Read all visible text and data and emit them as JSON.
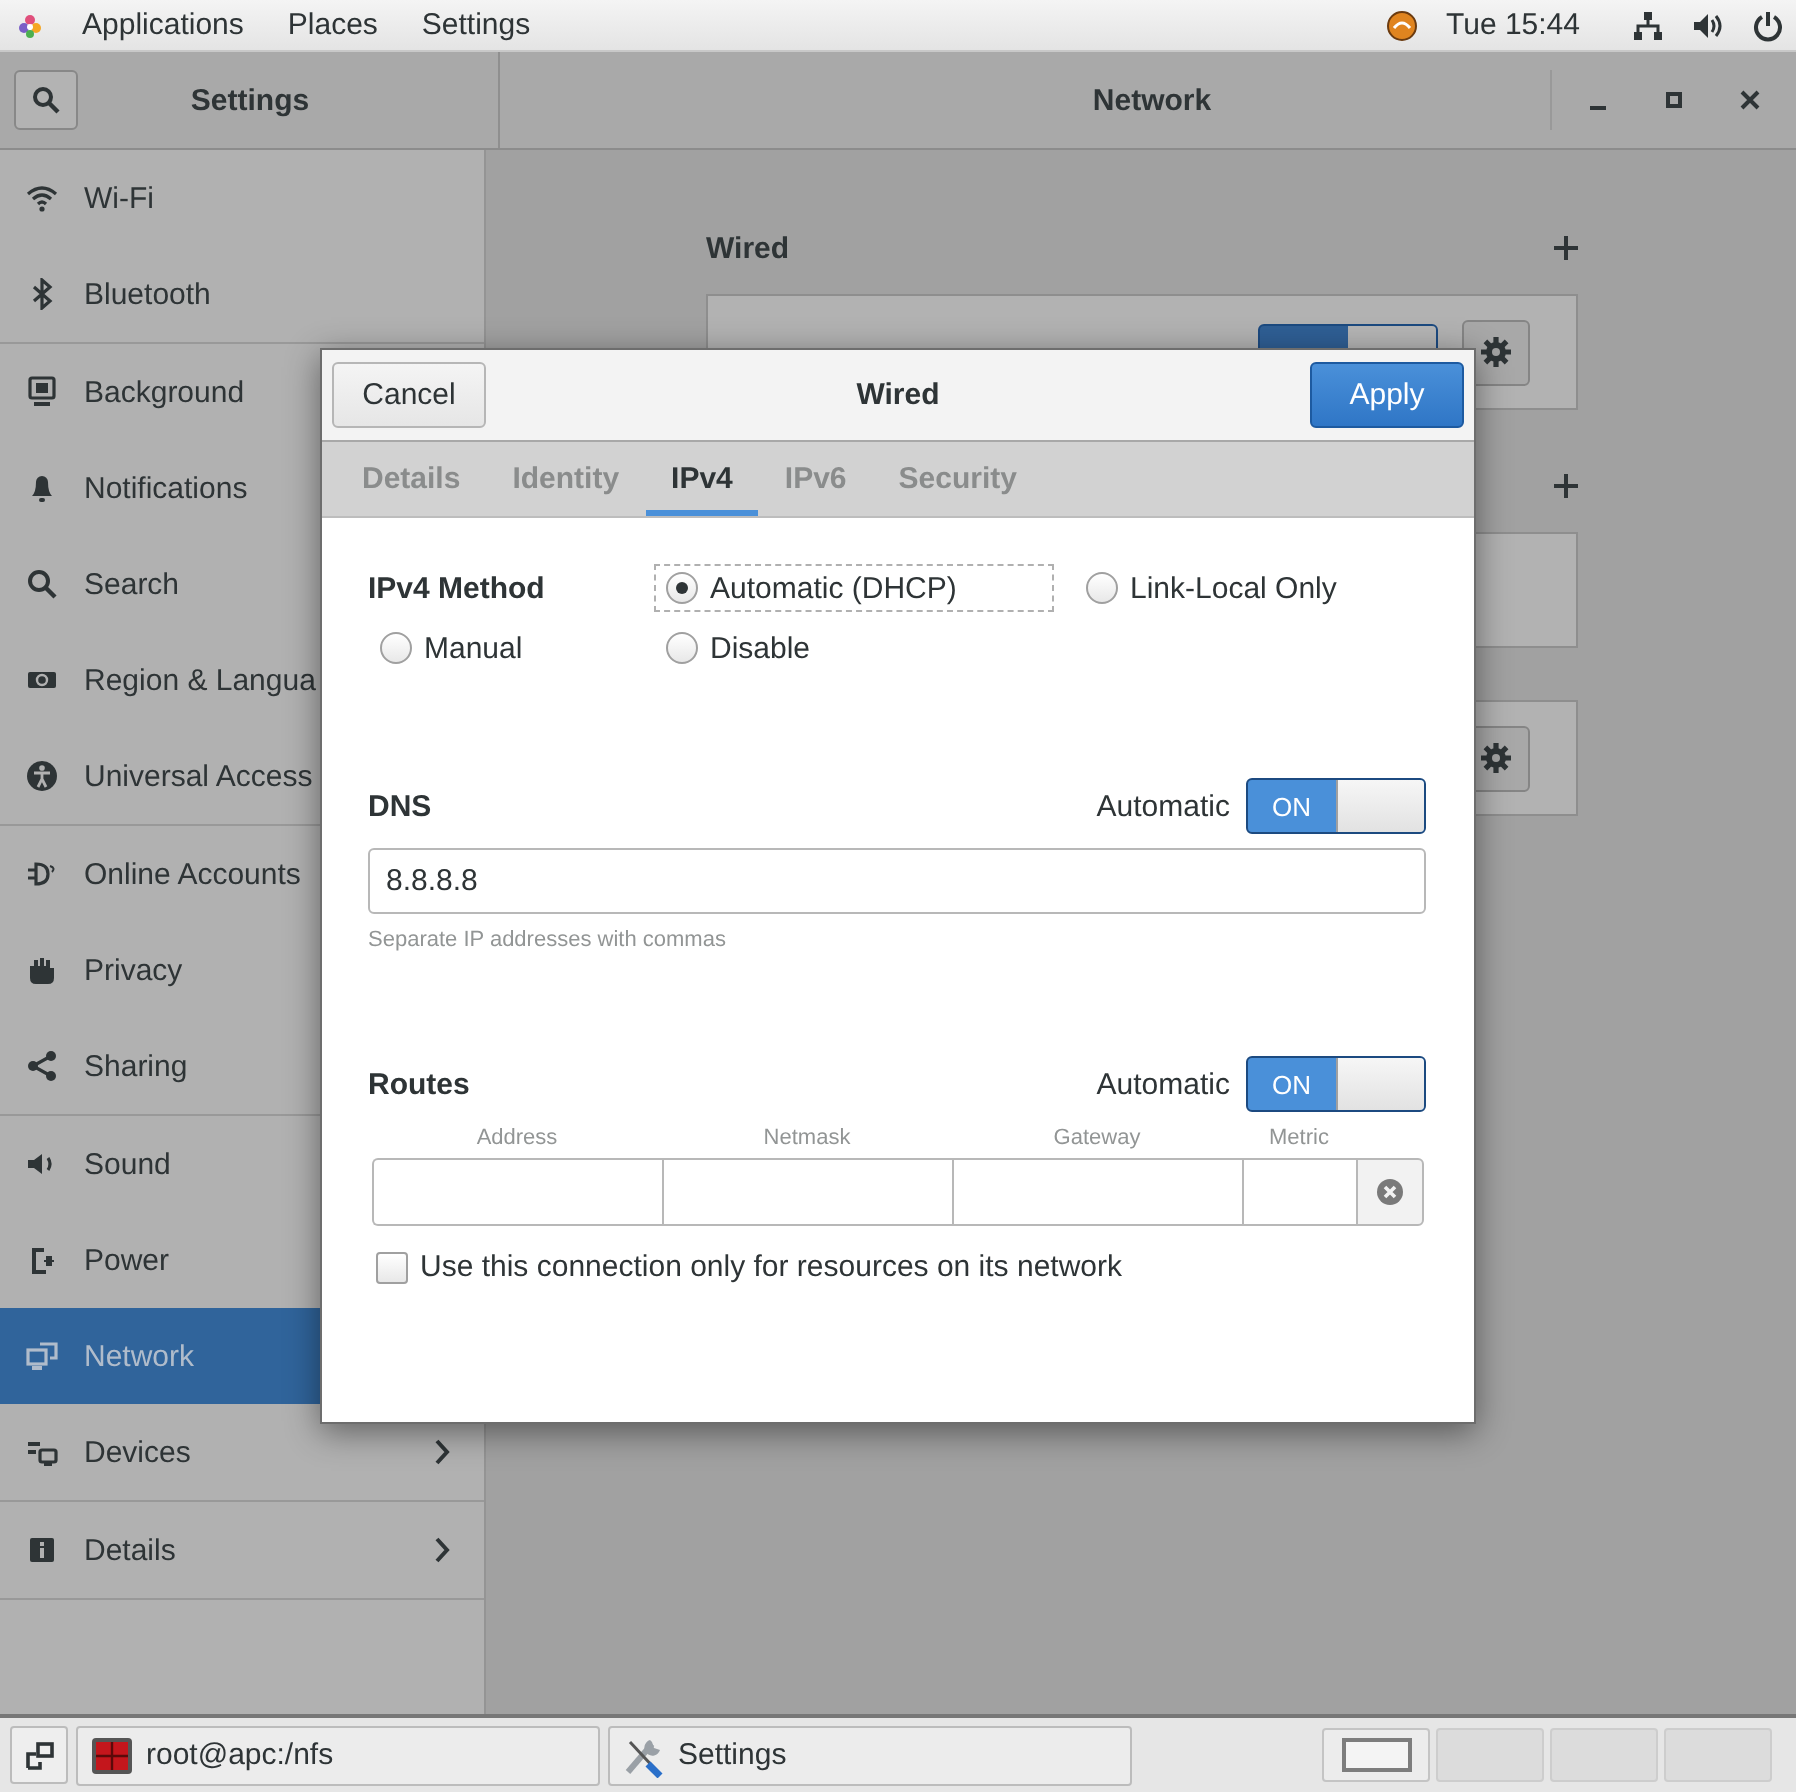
{
  "top_bar": {
    "menus": [
      "Applications",
      "Places",
      "Settings"
    ],
    "clock": "Tue 15:44"
  },
  "settings_window": {
    "sidebar_title": "Settings",
    "title": "Network",
    "sidebar": {
      "groups": [
        [
          {
            "label": "Wi-Fi",
            "selected": false,
            "kind": "page"
          },
          {
            "label": "Bluetooth",
            "selected": false,
            "kind": "page"
          }
        ],
        [
          {
            "label": "Background",
            "selected": false,
            "kind": "page"
          },
          {
            "label": "Notifications",
            "selected": false,
            "kind": "page"
          },
          {
            "label": "Search",
            "selected": false,
            "kind": "page"
          },
          {
            "label": "Region & Langua",
            "selected": false,
            "kind": "page"
          },
          {
            "label": "Universal Access",
            "selected": false,
            "kind": "page"
          }
        ],
        [
          {
            "label": "Online Accounts",
            "selected": false,
            "kind": "page"
          },
          {
            "label": "Privacy",
            "selected": false,
            "kind": "page"
          },
          {
            "label": "Sharing",
            "selected": false,
            "kind": "page"
          }
        ],
        [
          {
            "label": "Sound",
            "selected": false,
            "kind": "page"
          },
          {
            "label": "Power",
            "selected": false,
            "kind": "page"
          },
          {
            "label": "Network",
            "selected": true,
            "kind": "page"
          },
          {
            "label": "Devices",
            "selected": false,
            "kind": "submenu"
          }
        ],
        [
          {
            "label": "Details",
            "selected": false,
            "kind": "submenu"
          }
        ]
      ]
    },
    "sections": [
      {
        "kind": "heading",
        "title": "Wired",
        "cards": [
          {
            "kind": "switch_gear",
            "switch_on": true
          }
        ]
      },
      {
        "kind": "heading",
        "cards": [
          {
            "kind": "plain"
          }
        ]
      },
      {
        "kind": "bare",
        "cards": [
          {
            "kind": "gear"
          }
        ]
      }
    ]
  },
  "dialog": {
    "title": "Wired",
    "cancel": "Cancel",
    "apply": "Apply",
    "tabs": [
      {
        "label": "Details",
        "selected": false
      },
      {
        "label": "Identity",
        "selected": false
      },
      {
        "label": "IPv4",
        "selected": true
      },
      {
        "label": "IPv6",
        "selected": false
      },
      {
        "label": "Security",
        "selected": false
      }
    ],
    "method_label": "IPv4 Method",
    "methods": [
      {
        "label": "Automatic (DHCP)",
        "selected": true,
        "focused": true
      },
      {
        "label": "Link-Local Only",
        "selected": false,
        "focused": false
      },
      {
        "label": "Manual",
        "selected": false,
        "focused": false
      },
      {
        "label": "Disable",
        "selected": false,
        "focused": false
      }
    ],
    "dns": {
      "label": "DNS",
      "auto_label": "Automatic",
      "auto_on": true,
      "switch_text": "ON",
      "value": "8.8.8.8",
      "hint": "Separate IP addresses with commas"
    },
    "routes": {
      "label": "Routes",
      "auto_label": "Automatic",
      "auto_on": true,
      "switch_text": "ON",
      "columns": [
        "Address",
        "Netmask",
        "Gateway",
        "Metric"
      ]
    },
    "only_local": {
      "label": "Use this connection only for resources on its network",
      "checked": false
    }
  },
  "taskbar": {
    "windows": [
      {
        "label": "root@apc:/nfs",
        "kind": "terminal"
      },
      {
        "label": "Settings",
        "kind": "settings"
      }
    ],
    "workspaces": [
      {
        "selected": true
      },
      {
        "selected": false
      },
      {
        "selected": false
      },
      {
        "selected": false
      }
    ]
  }
}
